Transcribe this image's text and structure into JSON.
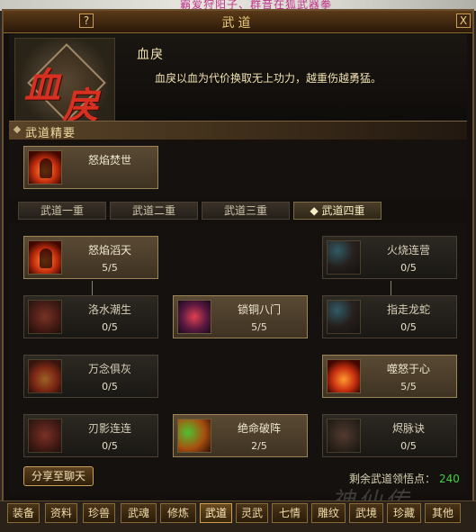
{
  "background_text": "霸爱狩阳子、群音在狐武器拳",
  "window": {
    "title": "武道",
    "help_label": "?",
    "close_label": "X"
  },
  "skill": {
    "emblem_chars": [
      "血",
      "戾"
    ],
    "name": "血戾",
    "description": "血戾以血为代价换取无上功力，越重伤越勇猛。"
  },
  "essence": {
    "section_label": "武道精要",
    "card": {
      "name": "怒焰焚世",
      "icon": "fire-rage-icon"
    }
  },
  "realm_tabs": [
    {
      "label": "武道一重",
      "active": false
    },
    {
      "label": "武道二重",
      "active": false
    },
    {
      "label": "武道三重",
      "active": false
    },
    {
      "label": "◆ 武道四重",
      "active": true
    }
  ],
  "tree": {
    "nodes": [
      {
        "name": "怒焰滔天",
        "progress": "5/5",
        "icon": "fire-rage-icon",
        "active": true
      },
      {
        "name": "火烧连营",
        "progress": "0/5",
        "icon": "blue-flame-icon",
        "active": false
      },
      {
        "name": "洛水潮生",
        "progress": "0/5",
        "icon": "blade-icon",
        "active": false
      },
      {
        "name": "锁铜八门",
        "progress": "5/5",
        "icon": "skull-icon",
        "active": true
      },
      {
        "name": "指走龙蛇",
        "progress": "0/5",
        "icon": "blue-flame-icon",
        "active": false
      },
      {
        "name": "万念俱灰",
        "progress": "0/5",
        "icon": "fire-blade-icon",
        "active": false
      },
      {
        "name": "噬怒于心",
        "progress": "5/5",
        "icon": "fire-heart-icon",
        "active": true
      },
      {
        "name": "刃影连连",
        "progress": "0/5",
        "icon": "blade-icon",
        "active": false
      },
      {
        "name": "绝命破阵",
        "progress": "2/5",
        "icon": "green-strike-icon",
        "active": true
      },
      {
        "name": "烬脉诀",
        "progress": "0/5",
        "icon": "ember-icon",
        "active": false
      }
    ]
  },
  "share_button": "分享至聊天",
  "points": {
    "label": "剩余武道领悟点：",
    "value": "240"
  },
  "watermark": "神仙传",
  "bottom_tabs": [
    {
      "label": "装备",
      "active": false
    },
    {
      "label": "资料",
      "active": false
    },
    {
      "label": "珍兽",
      "active": false
    },
    {
      "label": "武魂",
      "active": false
    },
    {
      "label": "修炼",
      "active": false
    },
    {
      "label": "武道",
      "active": true
    },
    {
      "label": "灵武",
      "active": false
    },
    {
      "label": "七情",
      "active": false
    },
    {
      "label": "雕纹",
      "active": false
    },
    {
      "label": "武境",
      "active": false
    },
    {
      "label": "珍藏",
      "active": false
    },
    {
      "label": "其他",
      "active": false
    }
  ],
  "colors": {
    "accent_gold": "#e8c878",
    "points_green": "#40d040",
    "active_card_border": "#9a8458"
  }
}
